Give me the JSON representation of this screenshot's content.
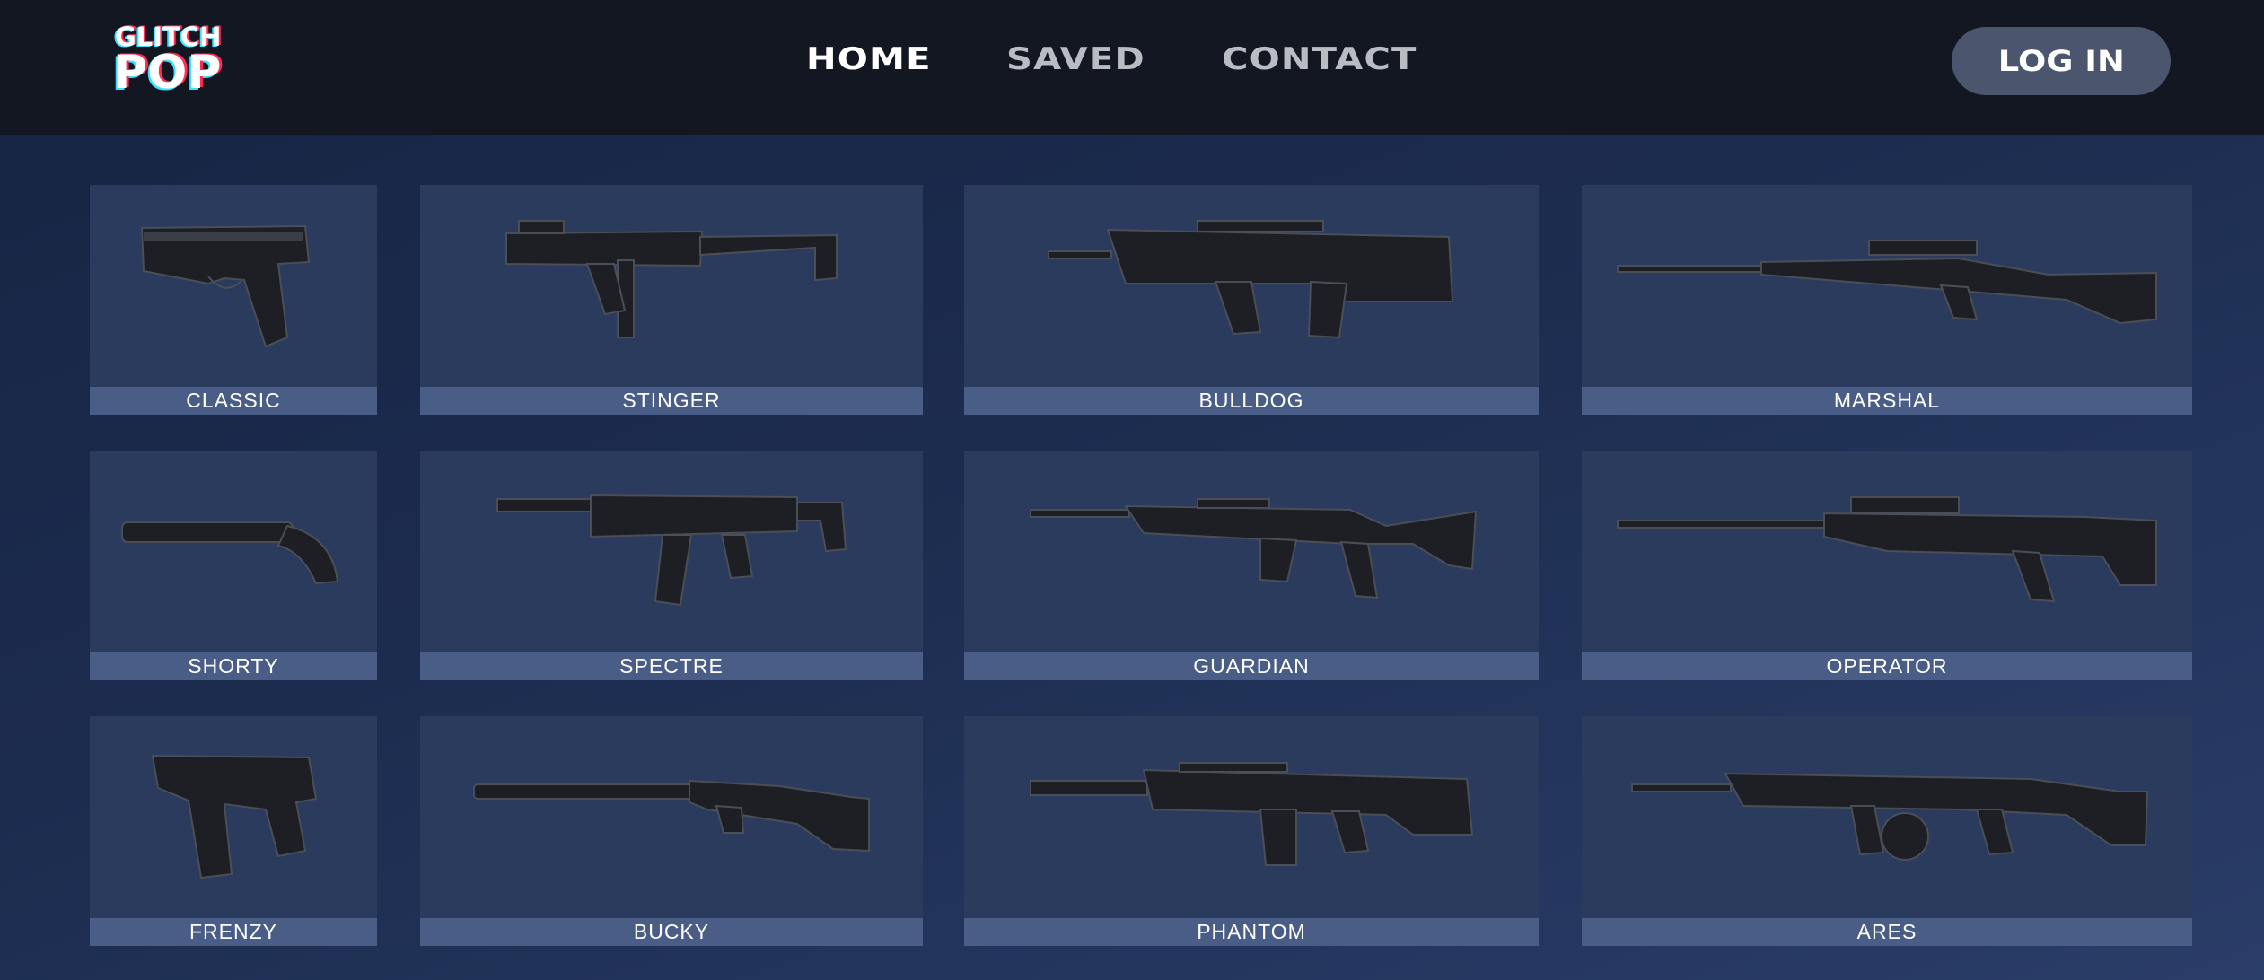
{
  "logo": {
    "line1": "GLITCH",
    "line2": "POP"
  },
  "nav": {
    "home": "HOME",
    "saved": "SAVED",
    "contact": "CONTACT"
  },
  "login_label": "LOG IN",
  "weapons": [
    {
      "name": "CLASSIC",
      "icon": "pistol-icon"
    },
    {
      "name": "STINGER",
      "icon": "smg-icon"
    },
    {
      "name": "BULLDOG",
      "icon": "rifle-icon"
    },
    {
      "name": "MARSHAL",
      "icon": "sniper-icon"
    },
    {
      "name": "SHORTY",
      "icon": "sawed-off-shotgun-icon"
    },
    {
      "name": "SPECTRE",
      "icon": "smg-icon"
    },
    {
      "name": "GUARDIAN",
      "icon": "rifle-icon"
    },
    {
      "name": "OPERATOR",
      "icon": "sniper-icon"
    },
    {
      "name": "FRENZY",
      "icon": "machine-pistol-icon"
    },
    {
      "name": "BUCKY",
      "icon": "shotgun-icon"
    },
    {
      "name": "PHANTOM",
      "icon": "rifle-icon"
    },
    {
      "name": "ARES",
      "icon": "machine-gun-icon"
    }
  ],
  "colors": {
    "header_bg": "#121722",
    "page_bg": "#1c2c4f",
    "card_bg": "#2b3b5e",
    "label_bg": "#4a5d86",
    "login_bg": "#4b566e",
    "logo_cyan": "#3fe0ff",
    "logo_red": "#ff2d55"
  }
}
